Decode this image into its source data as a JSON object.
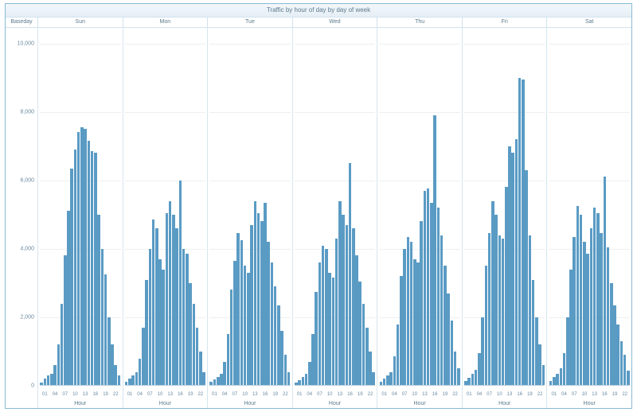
{
  "title": "Traffic by hour of day by day of week",
  "corner_label": "Baseday",
  "xlabel": "Hour",
  "chart_data": {
    "type": "bar",
    "ylim": [
      0,
      10500
    ],
    "y_ticks": [
      {
        "v": 0,
        "label": "0"
      },
      {
        "v": 2000,
        "label": "2,000"
      },
      {
        "v": 4000,
        "label": "4,000"
      },
      {
        "v": 6000,
        "label": "6,000"
      },
      {
        "v": 8000,
        "label": "8,000"
      },
      {
        "v": 10000,
        "label": "10,000"
      }
    ],
    "x_ticks": [
      "01",
      "04",
      "07",
      "10",
      "13",
      "16",
      "19",
      "22"
    ],
    "categories": [
      0,
      1,
      2,
      3,
      4,
      5,
      6,
      7,
      8,
      9,
      10,
      11,
      12,
      13,
      14,
      15,
      16,
      17,
      18,
      19,
      20,
      21,
      22,
      23
    ],
    "series": [
      {
        "name": "Sun",
        "values": [
          100,
          220,
          300,
          350,
          600,
          1200,
          2400,
          3800,
          5100,
          6350,
          6900,
          7400,
          7550,
          7500,
          7150,
          6850,
          6800,
          5000,
          4000,
          3250,
          2000,
          1200,
          600,
          300
        ]
      },
      {
        "name": "Mon",
        "values": [
          120,
          200,
          300,
          400,
          800,
          1700,
          3100,
          4000,
          4850,
          4600,
          3700,
          3400,
          5050,
          5400,
          5000,
          4600,
          6000,
          4000,
          3850,
          3000,
          2400,
          1700,
          1000,
          400
        ]
      },
      {
        "name": "Tue",
        "values": [
          120,
          180,
          260,
          360,
          700,
          1500,
          2800,
          3650,
          4450,
          4250,
          3500,
          3300,
          4700,
          5400,
          5050,
          4800,
          5350,
          4200,
          3600,
          2900,
          2350,
          1600,
          900,
          400
        ]
      },
      {
        "name": "Wed",
        "values": [
          100,
          170,
          260,
          360,
          700,
          1500,
          2750,
          3600,
          4100,
          4000,
          3300,
          3150,
          4300,
          5400,
          5000,
          4700,
          6500,
          4600,
          3800,
          3050,
          2400,
          1700,
          1000,
          400
        ]
      },
      {
        "name": "Thu",
        "values": [
          120,
          200,
          300,
          400,
          850,
          1800,
          3200,
          4000,
          4350,
          4200,
          3700,
          3600,
          4800,
          5700,
          5750,
          5350,
          7900,
          5200,
          4400,
          3500,
          2700,
          1900,
          1000,
          500
        ]
      },
      {
        "name": "Fri",
        "values": [
          150,
          240,
          340,
          460,
          950,
          2000,
          3500,
          4450,
          5400,
          5000,
          4400,
          4300,
          5800,
          7000,
          6800,
          7200,
          9000,
          8950,
          6300,
          4400,
          3100,
          2000,
          1200,
          600
        ]
      },
      {
        "name": "Sat",
        "values": [
          150,
          250,
          350,
          500,
          950,
          2000,
          3400,
          4350,
          5250,
          5000,
          4200,
          3850,
          4600,
          5200,
          5050,
          4450,
          6100,
          4050,
          3000,
          2350,
          1800,
          1300,
          900,
          450
        ]
      }
    ]
  }
}
